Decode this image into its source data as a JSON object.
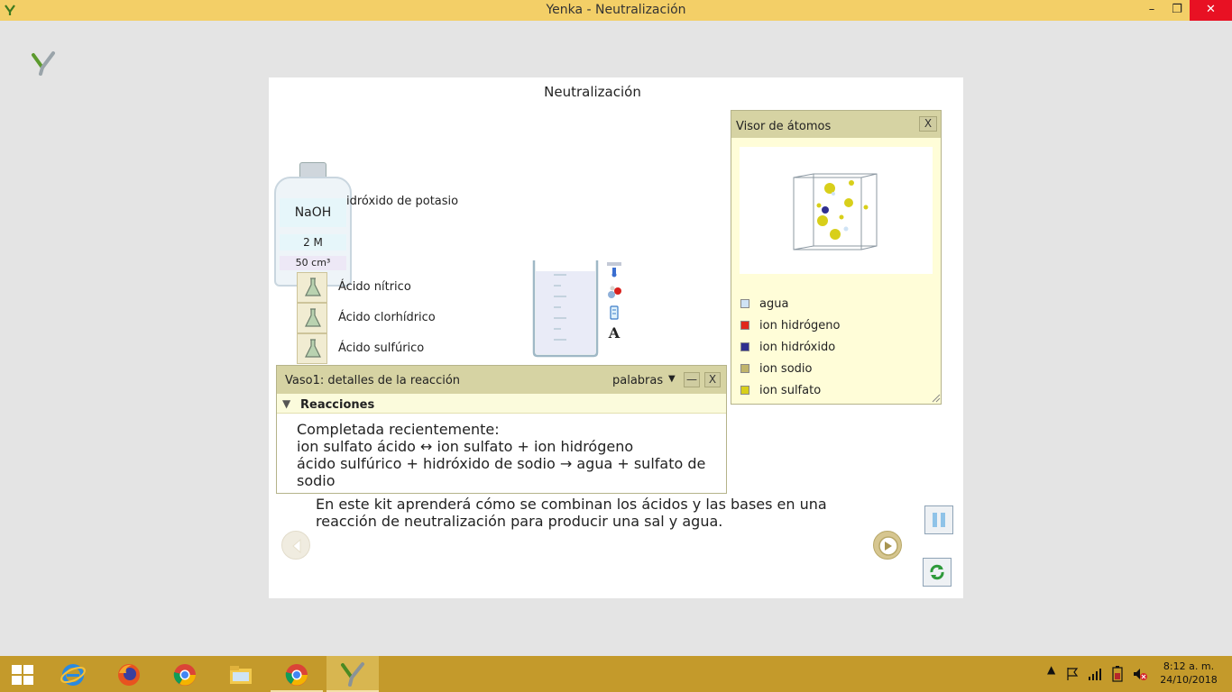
{
  "window": {
    "title": "Yenka - Neutralización",
    "minimize_label": "–",
    "restore_label": "❐",
    "close_label": "✕"
  },
  "stage": {
    "title": "Neutralización"
  },
  "bottle": {
    "formula": "NaOH",
    "concentration": "2 M",
    "volume": "50 cm³",
    "name": "idróxido de potasio"
  },
  "acids": [
    {
      "label": "Ácido nítrico",
      "icon": "flask-icon"
    },
    {
      "label": "Ácido clorhídrico",
      "icon": "flask-icon"
    },
    {
      "label": "Ácido sulfúrico",
      "icon": "flask-icon"
    }
  ],
  "beaker_tools": [
    "thermometer-icon",
    "molecules-icon",
    "cylinder-icon",
    "text-icon"
  ],
  "beaker_tools_text_glyph": "A",
  "reaction_panel": {
    "title": "Vaso1: detalles de la reacción",
    "words_label": "palabras",
    "minimize_label": "—",
    "close_label": "X",
    "section_label": "Reacciones",
    "lines": [
      "Completada recientemente:",
      "ion sulfato ácido ↔ ion sulfato + ion hidrógeno",
      "ácido sulfúrico + hidróxido de sodio → agua + sulfato de sodio"
    ]
  },
  "description": "En este kit aprenderá cómo se combinan los ácidos y las bases en una reacción de neutralización para producir una sal y agua.",
  "atom_viewer": {
    "title": "Visor de átomos",
    "close_label": "X",
    "legend": [
      {
        "label": "agua",
        "color": "#cfe3f5"
      },
      {
        "label": "ion hidrógeno",
        "color": "#e0261b"
      },
      {
        "label": "ion hidróxido",
        "color": "#2f2f8f"
      },
      {
        "label": "ion sodio",
        "color": "#c1b56a"
      },
      {
        "label": "ion sulfato",
        "color": "#d8cf1a"
      }
    ]
  },
  "colors": {
    "titlebar": "#f3cf67",
    "taskbar": "#c49a2b",
    "panel_header": "#d6d3a3",
    "panel_bg": "#fffdd8"
  },
  "taskbar": {
    "apps": [
      "windows-start-icon",
      "internet-explorer-icon",
      "firefox-icon",
      "chrome-icon",
      "file-explorer-icon",
      "chrome-icon",
      "yenka-icon"
    ],
    "tray_chevron": "▲",
    "time": "8:12 a. m.",
    "date": "24/10/2018"
  }
}
